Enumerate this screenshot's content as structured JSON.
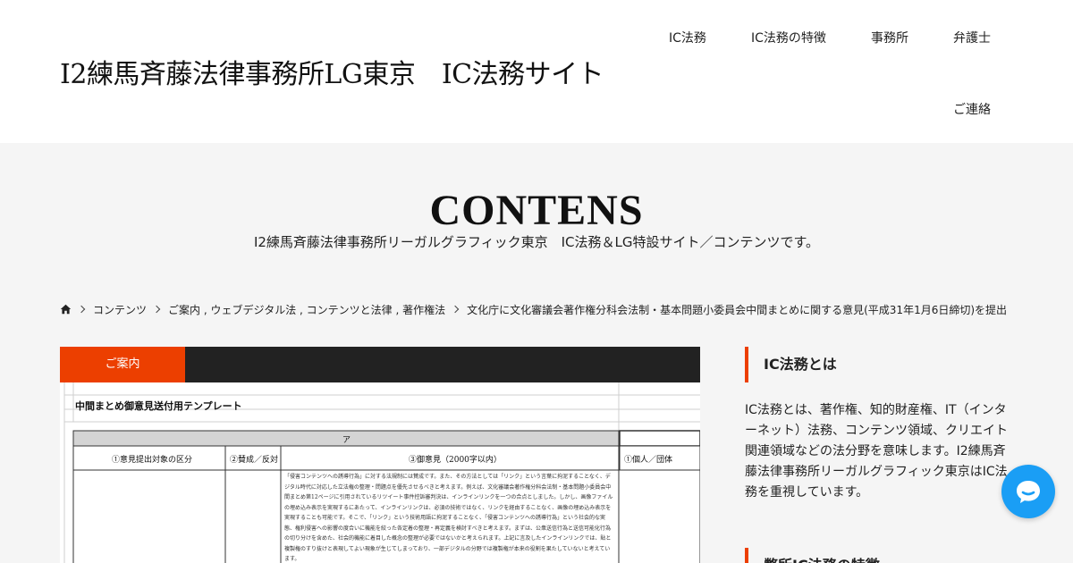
{
  "header": {
    "site_title": "I2練馬斉藤法律事務所LG東京　IC法務サイト",
    "nav": [
      "IC法務",
      "IC法務の特徴",
      "事務所",
      "弁護士",
      "ご連絡"
    ]
  },
  "hero": {
    "title": "CONTENS",
    "subtitle": "I2練馬斉藤法律事務所リーガルグラフィック東京　IC法務＆LG特設サイト／コンテンツです。"
  },
  "breadcrumb": {
    "home_icon": "home-icon",
    "items": [
      "コンテンツ",
      "ご案内 , ウェブデジタル法 , コンテンツと法律 , 著作権法",
      "文化庁に文化審議会著作権分科会法制・基本問題小委員会中間まとめに関する意見(平成31年1月6日締切)を提出"
    ]
  },
  "article": {
    "category": "ご案内",
    "doc": {
      "title": "中間まとめ御意見送付用テンプレート",
      "section_label": "ア",
      "col1": "①意見提出対象の区分",
      "col2": "②賛成／反対",
      "col3": "③御意見（2000字以内）",
      "col4": "①個人／団体",
      "body": "「侵害コンテンツへの誘導行為」に対する法規制には賛成です。また、その方法としては「リンク」という言葉に拘泥することなく、デジタル時代に対応した立法権の整理・問題点を優先させるべきと考えます。例えば、文化審議会著作権分科会法制・基本問題小委員会中間まとめ第12ページに引用されているリツイート事件控訴審判決は、インラインリンクを一つの合点としました。しかし、画像ファイルの埋め込み表示を実現するにあたって、インラインリンクは、必須の技術ではなく、リンクを経由することなく、画像の埋め込み表示を実現することも可能です。そこで、「リンク」という技術用語に拘泥することなく、「侵害コンテンツへの誘導行為」という社会的な実態、権利侵害への影響の度合いに機能を絞った各定着の整理・再定義を検討すべきと考えます。まずは、公衆送信行為と送信可能化行為の切り分けを含めた、社会的機能に着目した概念の整理が必要ではないかと考えられます。上記に言及したインラインリンクでは、貼と複製権のすり抜けと表現してよい現象が生じてしまっており、一部デジタルの分野では複製権が本来の役割を果たしていないと考えています。"
    }
  },
  "sidebar": {
    "widget1_title": "IC法務とは",
    "widget1_body": "IC法務とは、著作権、知的財産権、IT（インターネット）法務、コンテンツ領域、クリエイト関連領域などの法分野を意味します。I2練馬斉藤法律事務所リーガルグラフィック東京はIC法務を重視しています。",
    "widget2_title": "弊所IC法務の特徴"
  },
  "chat": {
    "icon": "chat-icon"
  },
  "colors": {
    "accent": "#ec3f00",
    "dark": "#222222",
    "chat": "#1a9ef5",
    "band": "#f5f5f5"
  }
}
